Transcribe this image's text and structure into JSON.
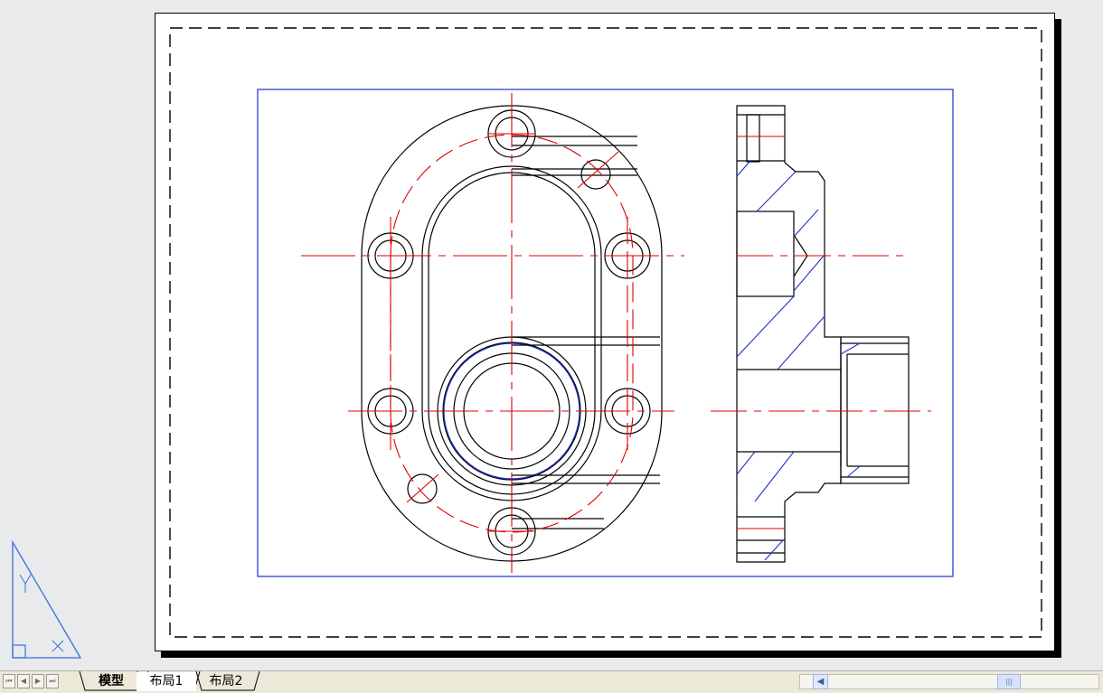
{
  "layout_tabs": [
    {
      "label": "模型",
      "active": false
    },
    {
      "label": "布局1",
      "active": true
    },
    {
      "label": "布局2",
      "active": false
    }
  ],
  "nav_buttons": [
    "first-tab",
    "previous-tab",
    "next-tab",
    "last-tab"
  ],
  "icons": {
    "first": "⏮",
    "prev": "◀",
    "next": "▶",
    "last": "⏭",
    "scroll_left": "◀",
    "scroll_thumb": "|||"
  },
  "colors": {
    "background": "#e9eaec",
    "paper": "#ffffff",
    "outline": "#000000",
    "centerline": "#e00000",
    "viewport": "#1c2fcc",
    "ucs": "#3a6fd8"
  }
}
